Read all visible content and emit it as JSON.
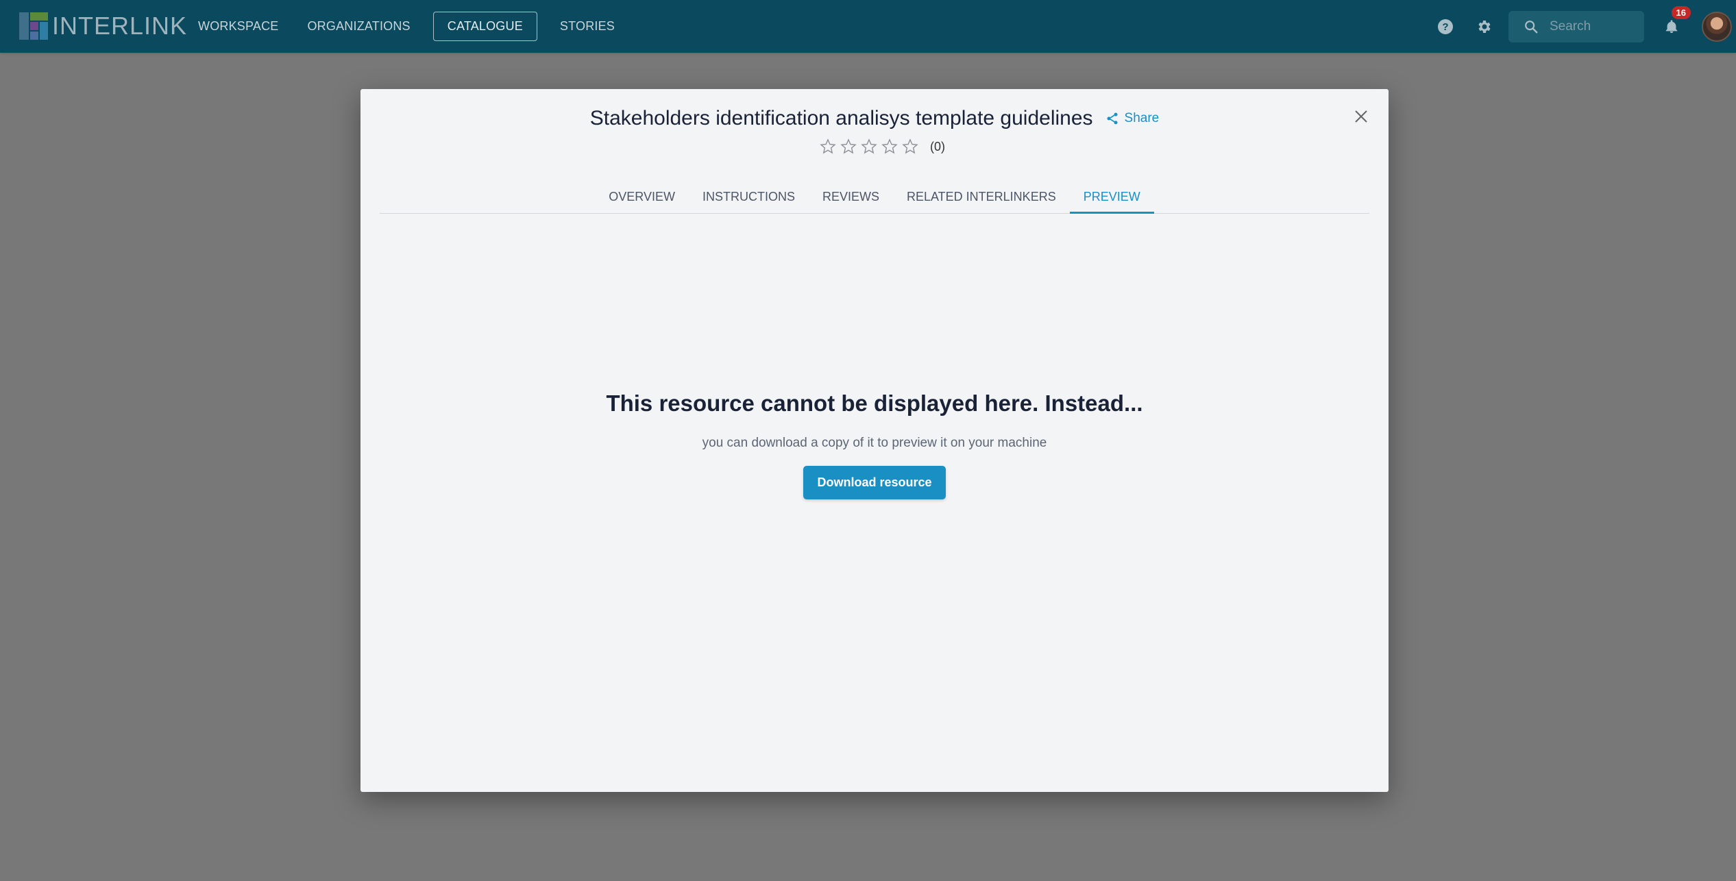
{
  "appbar": {
    "logo_text": "INTERLINK",
    "nav": [
      {
        "label": "WORKSPACE"
      },
      {
        "label": "ORGANIZATIONS"
      },
      {
        "label": "CATALOGUE",
        "active": true
      },
      {
        "label": "STORIES"
      }
    ],
    "help_icon": "help-icon",
    "settings_icon": "gear-icon",
    "search_placeholder": "Search",
    "notification_count": "16"
  },
  "modal": {
    "title": "Stakeholders identification analisys template guidelines",
    "share_label": "Share",
    "rating": {
      "stars": 0,
      "max": 5,
      "count_label": "(0)"
    },
    "tabs": [
      {
        "label": "OVERVIEW"
      },
      {
        "label": "INSTRUCTIONS"
      },
      {
        "label": "REVIEWS"
      },
      {
        "label": "RELATED INTERLINKERS"
      },
      {
        "label": "PREVIEW",
        "active": true
      }
    ],
    "preview": {
      "headline": "This resource cannot be displayed here. Instead...",
      "subtext": "you can download a copy of it to preview it on your machine",
      "download_label": "Download resource"
    }
  },
  "colors": {
    "appbar": "#0b4a5e",
    "accent": "#1a8fc4",
    "backdrop": "#787878",
    "modal_bg": "#f3f4f6",
    "badge": "#c62828"
  }
}
